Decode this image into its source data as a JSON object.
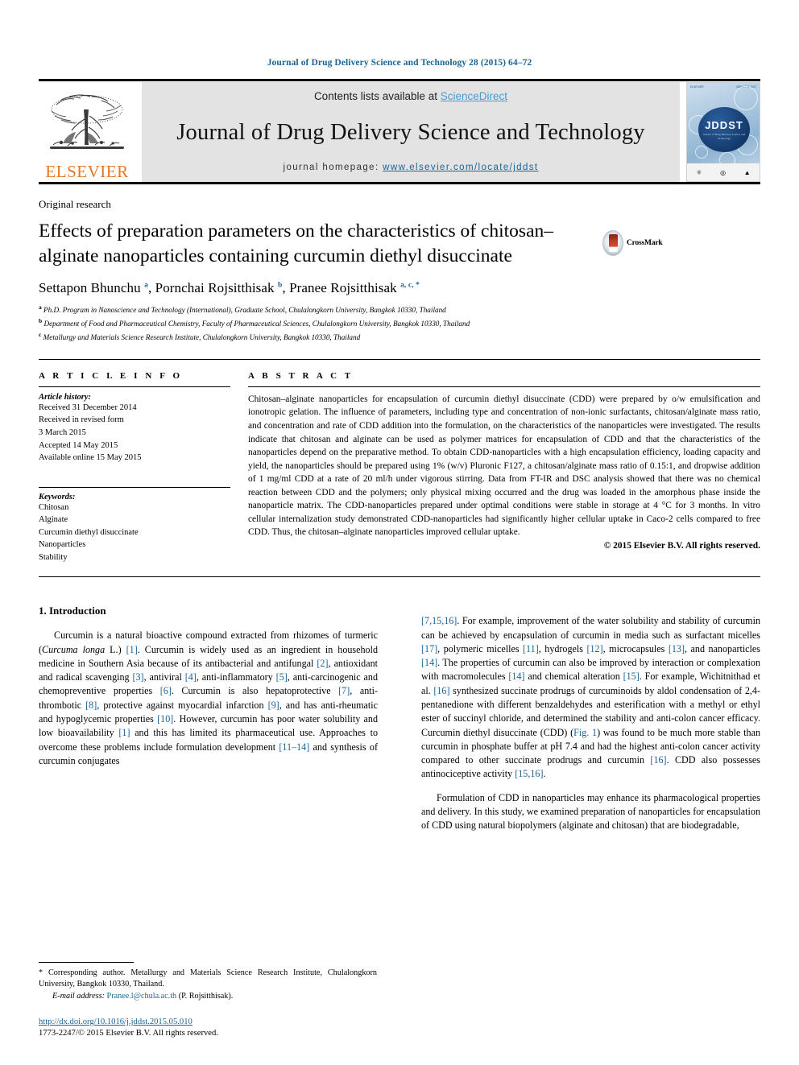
{
  "running_head": "Journal of Drug Delivery Science and Technology 28 (2015) 64–72",
  "masthead": {
    "contents_prefix": "Contents lists available at ",
    "sciencedirect": "ScienceDirect",
    "journal_title": "Journal of Drug Delivery Science and Technology",
    "homepage_prefix": "journal homepage: ",
    "homepage_url": "www.elsevier.com/locate/jddst",
    "publisher": "ELSEVIER",
    "publisher_logo": "elsevier-tree-logo",
    "cover": {
      "acronym": "JDDST",
      "subtitle": "Journal of Drug Delivery Science and Technology",
      "top_left": "ELSEVIER",
      "top_right": "ISSN 1773-2247"
    }
  },
  "article": {
    "kicker": "Original research",
    "title": "Effects of preparation parameters on the characteristics of chitosan–alginate nanoparticles containing curcumin diethyl disuccinate",
    "crossmark_label": "CrossMark",
    "authors_html": "Settapon Bhunchu <sup>a</sup>, Pornchai Rojsitthisak <sup>b</sup>, Pranee Rojsitthisak <sup>a, c, *</sup>",
    "affiliations": [
      {
        "marker": "a",
        "text": "Ph.D. Program in Nanoscience and Technology (International), Graduate School, Chulalongkorn University, Bangkok 10330, Thailand"
      },
      {
        "marker": "b",
        "text": "Department of Food and Pharmaceutical Chemistry, Faculty of Pharmaceutical Sciences, Chulalongkorn University, Bangkok 10330, Thailand"
      },
      {
        "marker": "c",
        "text": "Metallurgy and Materials Science Research Institute, Chulalongkorn University, Bangkok 10330, Thailand"
      }
    ]
  },
  "article_info": {
    "heading": "A R T I C L E  I N F O",
    "history_label": "Article history:",
    "history": [
      "Received 31 December 2014",
      "Received in revised form",
      "3 March 2015",
      "Accepted 14 May 2015",
      "Available online 15 May 2015"
    ],
    "keywords_label": "Keywords:",
    "keywords": [
      "Chitosan",
      "Alginate",
      "Curcumin diethyl disuccinate",
      "Nanoparticles",
      "Stability"
    ]
  },
  "abstract": {
    "heading": "A B S T R A C T",
    "text": "Chitosan–alginate nanoparticles for encapsulation of curcumin diethyl disuccinate (CDD) were prepared by o/w emulsification and ionotropic gelation. The influence of parameters, including type and concentration of non-ionic surfactants, chitosan/alginate mass ratio, and concentration and rate of CDD addition into the formulation, on the characteristics of the nanoparticles were investigated. The results indicate that chitosan and alginate can be used as polymer matrices for encapsulation of CDD and that the characteristics of the nanoparticles depend on the preparative method. To obtain CDD-nanoparticles with a high encapsulation efficiency, loading capacity and yield, the nanoparticles should be prepared using 1% (w/v) Pluronic F127, a chitosan/alginate mass ratio of 0.15:1, and dropwise addition of 1 mg/ml CDD at a rate of 20 ml/h under vigorous stirring. Data from FT-IR and DSC analysis showed that there was no chemical reaction between CDD and the polymers; only physical mixing occurred and the drug was loaded in the amorphous phase inside the nanoparticle matrix. The CDD-nanoparticles prepared under optimal conditions were stable in storage at 4 °C for 3 months. In vitro cellular internalization study demonstrated CDD-nanoparticles had significantly higher cellular uptake in Caco-2 cells compared to free CDD. Thus, the chitosan–alginate nanoparticles improved cellular uptake.",
    "copyright": "© 2015 Elsevier B.V. All rights reserved."
  },
  "body": {
    "section_title": "1. Introduction",
    "left_paragraph_html": "Curcumin is a natural bioactive compound extracted from rhizomes of turmeric (<span class=\"it\">Curcuma longa</span> L.) <span class=\"ref\">[1]</span>. Curcumin is widely used as an ingredient in household medicine in Southern Asia because of its antibacterial and antifungal <span class=\"ref\">[2]</span>, antioxidant and radical scavenging <span class=\"ref\">[3]</span>, antiviral <span class=\"ref\">[4]</span>, anti-inflammatory <span class=\"ref\">[5]</span>, anti-carcinogenic and chemopreventive properties <span class=\"ref\">[6]</span>. Curcumin is also hepatoprotective <span class=\"ref\">[7]</span>, anti-thrombotic <span class=\"ref\">[8]</span>, protective against myocardial infarction <span class=\"ref\">[9]</span>, and has anti-rheumatic and hypoglycemic properties <span class=\"ref\">[10]</span>. However, curcumin has poor water solubility and low bioavailability <span class=\"ref\">[1]</span> and this has limited its pharmaceutical use. Approaches to overcome these problems include formulation development <span class=\"ref\">[11–14]</span> and synthesis of curcumin conjugates",
    "right_paragraph_1_html": "<span class=\"ref\">[7,15,16]</span>. For example, improvement of the water solubility and stability of curcumin can be achieved by encapsulation of curcumin in media such as surfactant micelles <span class=\"ref\">[17]</span>, polymeric micelles <span class=\"ref\">[11]</span>, hydrogels <span class=\"ref\">[12]</span>, microcapsules <span class=\"ref\">[13]</span>, and nanoparticles <span class=\"ref\">[14]</span>. The properties of curcumin can also be improved by interaction or complexation with macromolecules <span class=\"ref\">[14]</span> and chemical alteration <span class=\"ref\">[15]</span>. For example, Wichitnithad et al. <span class=\"ref\">[16]</span> synthesized succinate prodrugs of curcuminoids by aldol condensation of 2,4-pentanedione with different benzaldehydes and esterification with a methyl or ethyl ester of succinyl chloride, and determined the stability and anti-colon cancer efficacy. Curcumin diethyl disuccinate (CDD) (<span class=\"ref\">Fig. 1</span>) was found to be much more stable than curcumin in phosphate buffer at pH 7.4 and had the highest anti-colon cancer activity compared to other succinate prodrugs and curcumin <span class=\"ref\">[16]</span>. CDD also possesses antinociceptive activity <span class=\"ref\">[15,16]</span>.",
    "right_paragraph_2_html": "Formulation of CDD in nanoparticles may enhance its pharmacological properties and delivery. In this study, we examined preparation of nanoparticles for encapsulation of CDD using natural biopolymers (alginate and chitosan) that are biodegradable,"
  },
  "footnote": {
    "corresponding_html": "* Corresponding author. Metallurgy and Materials Science Research Institute, Chulalongkorn University, Bangkok 10330, Thailand.",
    "email_label": "E-mail address:",
    "email": "Pranee.l@chula.ac.th",
    "email_owner": "(P. Rojsitthisak).",
    "doi": "http://dx.doi.org/10.1016/j.jddst.2015.05.010",
    "issn_line": "1773-2247/© 2015 Elsevier B.V. All rights reserved."
  },
  "colors": {
    "link": "#1a6496",
    "sciencedirect": "#4a9ad4",
    "elsevier_orange": "#E87722",
    "panel_gray": "#e3e3e3"
  }
}
